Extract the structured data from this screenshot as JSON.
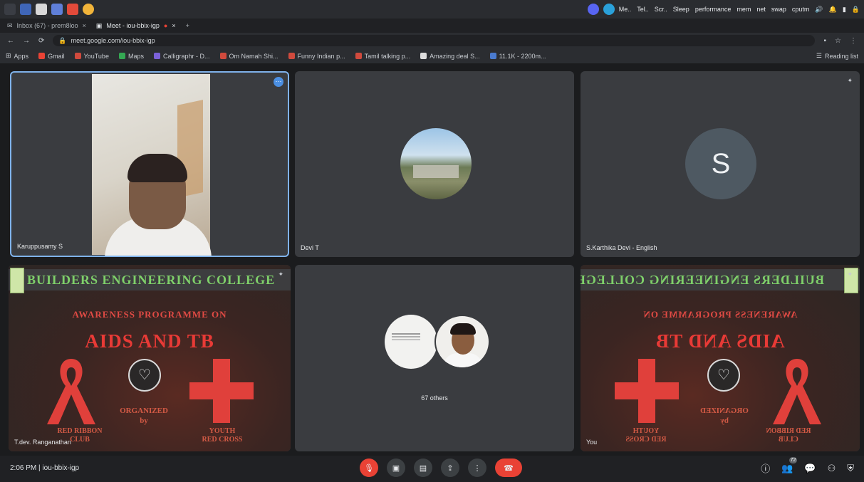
{
  "os": {
    "status_text": "performance",
    "tray": [
      "Me..",
      "Tel..",
      "Scr..",
      "Sleep",
      "mem",
      "net",
      "swap",
      "cputm"
    ]
  },
  "tabs": [
    {
      "label": "Inbox (67) - prem8loo",
      "active": false
    },
    {
      "label": "Meet - iou-bbix-igp",
      "active": true
    }
  ],
  "address": {
    "url": "meet.google.com/iou-bbix-igp"
  },
  "bookmarks": {
    "items": [
      "Apps",
      "Gmail",
      "YouTube",
      "Maps",
      "Calligraphr - D...",
      "Om Namah Shi...",
      "Funny Indian p...",
      "Tamil talking p...",
      "Amazing deal S...",
      "11.1K - 2200m..."
    ],
    "reading_list": "Reading list"
  },
  "tiles": [
    {
      "name": "Karuppusamy S"
    },
    {
      "name": "Devi T"
    },
    {
      "name": "S.Karthika Devi - English",
      "initial": "S"
    },
    {
      "name": "T.dev. Ranganathan"
    },
    {
      "others_label": "67 others"
    },
    {
      "name": "You"
    }
  ],
  "banner": {
    "college": "BUILDERS ENGINEERING COLLEGE",
    "awareness": "AWARENESS PROGRAMME ON",
    "topic": "AIDS AND TB",
    "organized": "ORGANIZED",
    "by": "by",
    "red_ribbon": "RED RIBBON",
    "club": "CLUB",
    "youth": "YOUTH",
    "red_cross": "RED CROSS"
  },
  "bottom": {
    "time": "2:06 PM",
    "meeting_code": "iou-bbix-igp",
    "participants_count": "72"
  },
  "colors": {
    "accent_blue": "#7fb2ea",
    "end_call": "#e94235"
  }
}
